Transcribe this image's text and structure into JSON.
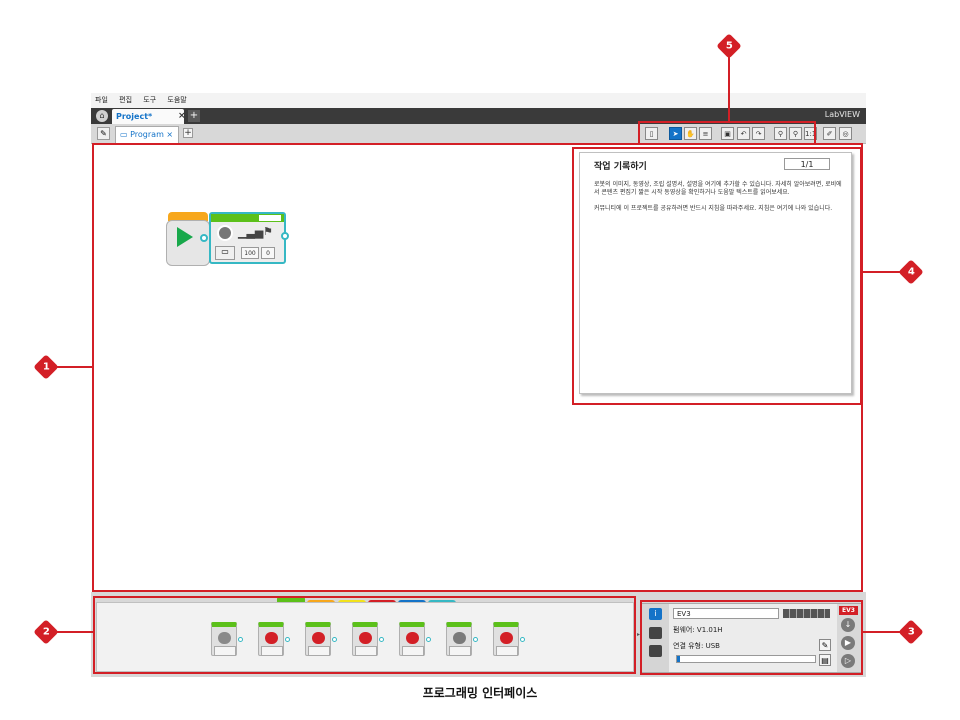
{
  "menu": [
    "파일",
    "편집",
    "도구",
    "도움말"
  ],
  "project_tab": {
    "label": "Project*",
    "close": "×",
    "add": "+"
  },
  "brand": "LabVIEW",
  "program_tab": {
    "label": "Program",
    "close": "×",
    "add": "+"
  },
  "toolbar": [
    "page",
    "pointer",
    "pan",
    "comment",
    "save",
    "undo",
    "redo",
    "zoom-out",
    "zoom-in",
    "zoom-reset"
  ],
  "toolbar_labels": {
    "zoom_reset": "1:1"
  },
  "motor_block": {
    "field1": "100",
    "field2": "0"
  },
  "content_editor": {
    "title": "작업 기록하기",
    "page": "1/1",
    "para1": "로봇의 이미지, 동영상, 조립 설명서, 설명을 여기에 추가할 수 있습니다. 자세히 알아보려면, 로비에서 콘텐츠 편집기 짧은 시작 동영상을 확인하거나 도움말 텍스트를 읽어보세요.",
    "para2": "커뮤니티에 이 프로젝트를 공유하려면 반드시 지침을 따라주세요. 지침은 여기에 나와 있습니다."
  },
  "palette_tab_colors": [
    "#5cc01a",
    "#f7a71c",
    "#f2e21b",
    "#d31f26",
    "#1473c8",
    "#36b8c4"
  ],
  "palette_blocks": [
    {
      "icon": "medium-motor-icon",
      "color": "#8a8a8a"
    },
    {
      "icon": "large-motor-icon",
      "color": "#d31f26"
    },
    {
      "icon": "move-steering-icon",
      "color": "#d31f26"
    },
    {
      "icon": "move-tank-icon",
      "color": "#d31f26"
    },
    {
      "icon": "display-icon",
      "color": "#d31f26"
    },
    {
      "icon": "sound-icon",
      "color": "#7a7a7a"
    },
    {
      "icon": "brick-status-light-icon",
      "color": "#d31f26"
    }
  ],
  "hardware": {
    "brick_name": "EV3",
    "firmware": "펌웨어: V1.01H",
    "connection_label": "연결 유형:",
    "connection_value": "USB",
    "badge": "EV3"
  },
  "callouts": [
    "1",
    "2",
    "3",
    "4",
    "5"
  ],
  "caption": "프로그래밍 인터페이스",
  "accent_red": "#d31f26"
}
